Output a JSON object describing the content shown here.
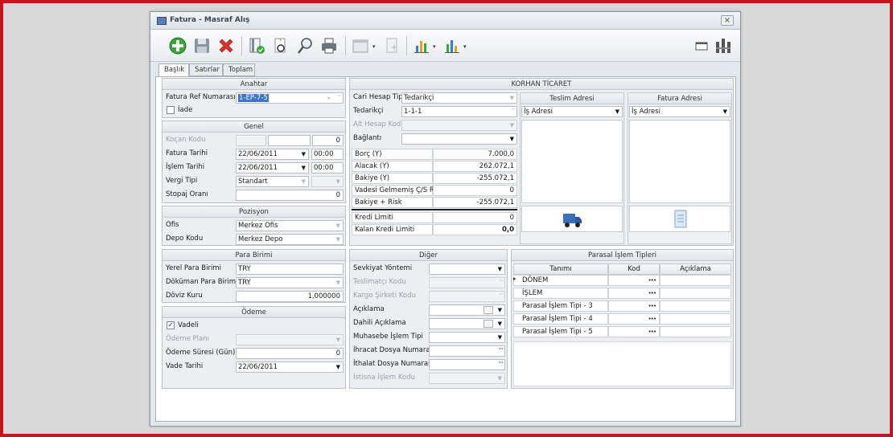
{
  "window": {
    "title": "Fatura - Masraf Alış",
    "close_label": "×"
  },
  "toolbar": {
    "icons": [
      "add-icon",
      "save-icon",
      "delete-icon",
      "document-check-icon",
      "preview-icon",
      "search-icon",
      "print-icon",
      "form-icon",
      "copy-icon",
      "chart-icon",
      "report-icon",
      "window-layout-icon",
      "sitemap-icon"
    ]
  },
  "tabs": [
    {
      "label": "Başlık"
    },
    {
      "label": "Satırlar"
    },
    {
      "label": "Toplam"
    }
  ],
  "anahtar": {
    "title": "Anahtar",
    "ref_label": "Fatura Ref Numarası",
    "ref_value": "1-EP-7-5",
    "iade_label": "İade"
  },
  "genel": {
    "title": "Genel",
    "kocan_label": "Koçan Kodu",
    "kocan_num": "0",
    "fatura_tarihi_label": "Fatura Tarihi",
    "fatura_tarihi": "22/06/2011",
    "fatura_saat": "00:00",
    "islem_tarihi_label": "İşlem Tarihi",
    "islem_tarihi": "22/06/2011",
    "islem_saat": "00:00",
    "vergi_tipi_label": "Vergi Tipi",
    "vergi_tipi": "Standart",
    "stopaj_label": "Stopaj Oranı",
    "stopaj": "0"
  },
  "pozisyon": {
    "title": "Pozisyon",
    "ofis_label": "Ofis",
    "ofis": "Merkez Ofis",
    "depo_label": "Depo Kodu",
    "depo": "Merkez Depo"
  },
  "para_birimi": {
    "title": "Para Birimi",
    "yerel_label": "Yerel Para Birimi",
    "yerel": "TRY",
    "dokuman_label": "Döküman Para Birimi",
    "dokuman": "TRY",
    "doviz_label": "Döviz Kuru",
    "doviz": "1,000000"
  },
  "odeme": {
    "title": "Ödeme",
    "vadeli_label": "Vadeli",
    "plani_label": "Ödeme Planı",
    "suresi_label": "Ödeme Süresi (Gün)",
    "suresi": "0",
    "vade_label": "Vade Tarihi",
    "vade": "22/06/2011"
  },
  "cari": {
    "title": "KORHAN TİCARET",
    "hesap_tipi_label": "Cari Hesap Tipi",
    "hesap_tipi": "Tedarikçi",
    "tedarikci_label": "Tedarikçi",
    "tedarikci": "1-1-1",
    "alt_hesap_label": "Alt Hesap Kodu",
    "baglanti_label": "Bağlantı",
    "balances": [
      {
        "label": "Borç (Y)",
        "value": "7.000,0"
      },
      {
        "label": "Alacak (Y)",
        "value": "262.072,1"
      },
      {
        "label": "Bakiye (Y)",
        "value": "-255.072,1"
      },
      {
        "label": "Vadesi Gelmemiş Ç/S Riski",
        "value": "0"
      },
      {
        "label": "Bakiye + Risk",
        "value": "-255.072,1"
      }
    ],
    "kredi_label": "Kredi Limiti",
    "kredi": "0",
    "kalan_label": "Kalan Kredi Limiti",
    "kalan": "0,0",
    "teslim_title": "Teslim Adresi",
    "teslim_value": "İş Adresi",
    "fatura_adr_title": "Fatura Adresi",
    "fatura_adr_value": "İş Adresi"
  },
  "diger": {
    "title": "Diğer",
    "sevkiyat_label": "Sevkiyat Yöntemi",
    "teslimatci_label": "Teslimatçı Kodu",
    "kargo_label": "Kargo Şirketi Kodu",
    "aciklama_label": "Açıklama",
    "dahili_label": "Dahili Açıklama",
    "muhasebe_label": "Muhasebe İşlem Tipi",
    "ihracat_label": "İhracat Dosya Numarası",
    "ithalat_label": "İthalat Dosya Numarası",
    "istisna_label": "İstisna İşlem Kodu"
  },
  "parasal": {
    "title": "Parasal İşlem Tipleri",
    "headers": [
      "Tanımı",
      "Kod",
      "Açıklama"
    ],
    "rows": [
      "DÖNEM",
      "İŞLEM",
      "Parasal İşlem Tipi - 3",
      "Parasal İşlem Tipi - 4",
      "Parasal İşlem Tipi - 5"
    ],
    "dots": "•••"
  },
  "colors": {
    "frame": "#c8141c",
    "highlight": "#3c74c7"
  }
}
